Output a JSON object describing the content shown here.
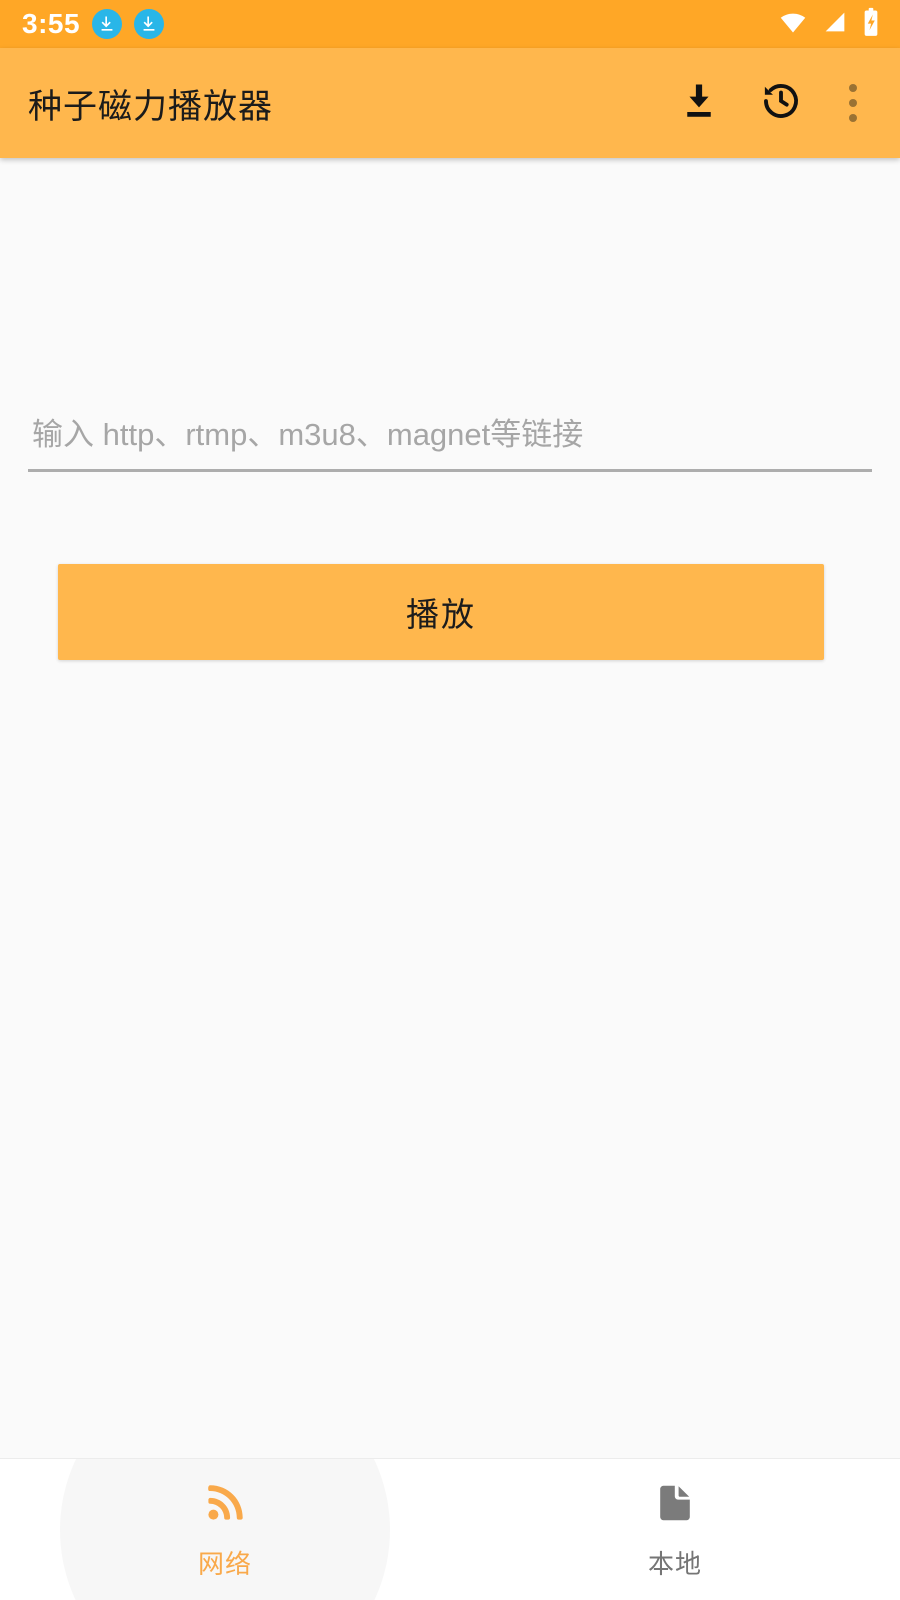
{
  "status_bar": {
    "time": "3:55",
    "background_color": "#FFA726",
    "notification_icons": [
      "download-icon",
      "download-icon"
    ],
    "system_icons": [
      "wifi-icon",
      "cellular-signal-icon",
      "battery-charging-icon"
    ]
  },
  "app_bar": {
    "title": "种子磁力播放器",
    "background_color": "#FFB74D",
    "actions": [
      {
        "name": "download-icon",
        "label": "下载"
      },
      {
        "name": "history-icon",
        "label": "历史"
      },
      {
        "name": "overflow-menu-icon",
        "label": "更多"
      }
    ]
  },
  "main": {
    "background_color": "#FAFAFA",
    "url_input": {
      "placeholder": "输入 http、rtmp、m3u8、magnet等链接",
      "value": ""
    },
    "play_button": {
      "label": "播放",
      "color": "#FFB74D"
    }
  },
  "bottom_nav": {
    "active_color": "#F9A94A",
    "inactive_color": "#757575",
    "items": [
      {
        "label": "网络",
        "icon": "rss-icon",
        "active": true
      },
      {
        "label": "本地",
        "icon": "file-document-icon",
        "active": false
      }
    ]
  }
}
